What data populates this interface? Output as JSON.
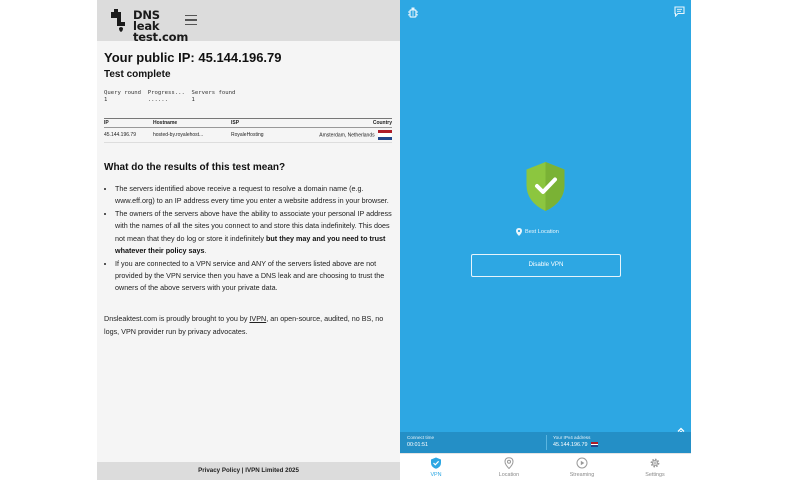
{
  "dns_site": {
    "logo_line1": "DNS leak",
    "logo_line2": "test.com",
    "ip_title": "Your public IP: 45.144.196.79",
    "status": "Test complete",
    "progress_header": "Query round  Progress...  Servers found",
    "progress_row": "1            ......       1",
    "table": {
      "headers": [
        "IP",
        "Hostname",
        "ISP",
        "Country"
      ],
      "rows": [
        {
          "ip": "45.144.196.79",
          "hostname": "hosted-by.royalehost...",
          "isp": "RoyaleHosting",
          "country": "Amsterdam, Netherlands"
        }
      ]
    },
    "question": "What do the results of this test mean?",
    "bullets": {
      "b1": "The servers identified above receive a request to resolve a domain name (e.g. www.eff.org) to an IP address every time you enter a website address in your browser.",
      "b2_start": "The owners of the servers above have the ability to associate your personal IP address with the names of all the sites you connect to and store this data indefinitely. This does not mean that they do log or store it indefinitely ",
      "b2_bold": "but they may and you need to trust whatever their policy says",
      "b2_end": ".",
      "b3": "If you are connected to a VPN service and ANY of the servers listed above are not provided by the VPN service then you have a DNS leak and are choosing to trust the owners of the above servers with your private data."
    },
    "credit_start": "Dnsleaktest.com is proudly brought to you by ",
    "credit_link": "IVPN",
    "credit_end": ", an open-source, audited, no BS, no logs, VPN provider run by privacy advocates.",
    "footer": "Privacy Policy | IVPN Limited 2025",
    "colors": {
      "header_bg": "#dcdcdc",
      "page_bg": "#f5f5f5"
    }
  },
  "vpn_app": {
    "location_label": "Best Location",
    "disable_button": "Disable VPN",
    "connect_time_label": "Connect time",
    "connect_time_value": "00:01:51",
    "ipv4_label": "Your IPv4 address",
    "ipv4_value": "45.144.196.79",
    "tabs": [
      {
        "label": "VPN",
        "icon": "shield-check-icon",
        "active": true
      },
      {
        "label": "Location",
        "icon": "location-pin-icon",
        "active": false
      },
      {
        "label": "Streaming",
        "icon": "play-circle-icon",
        "active": false
      },
      {
        "label": "Settings",
        "icon": "gear-icon",
        "active": false
      }
    ],
    "colors": {
      "accent": "#2da7e3",
      "shield": "#8cc63f",
      "info_bar": "#248fc6"
    }
  }
}
